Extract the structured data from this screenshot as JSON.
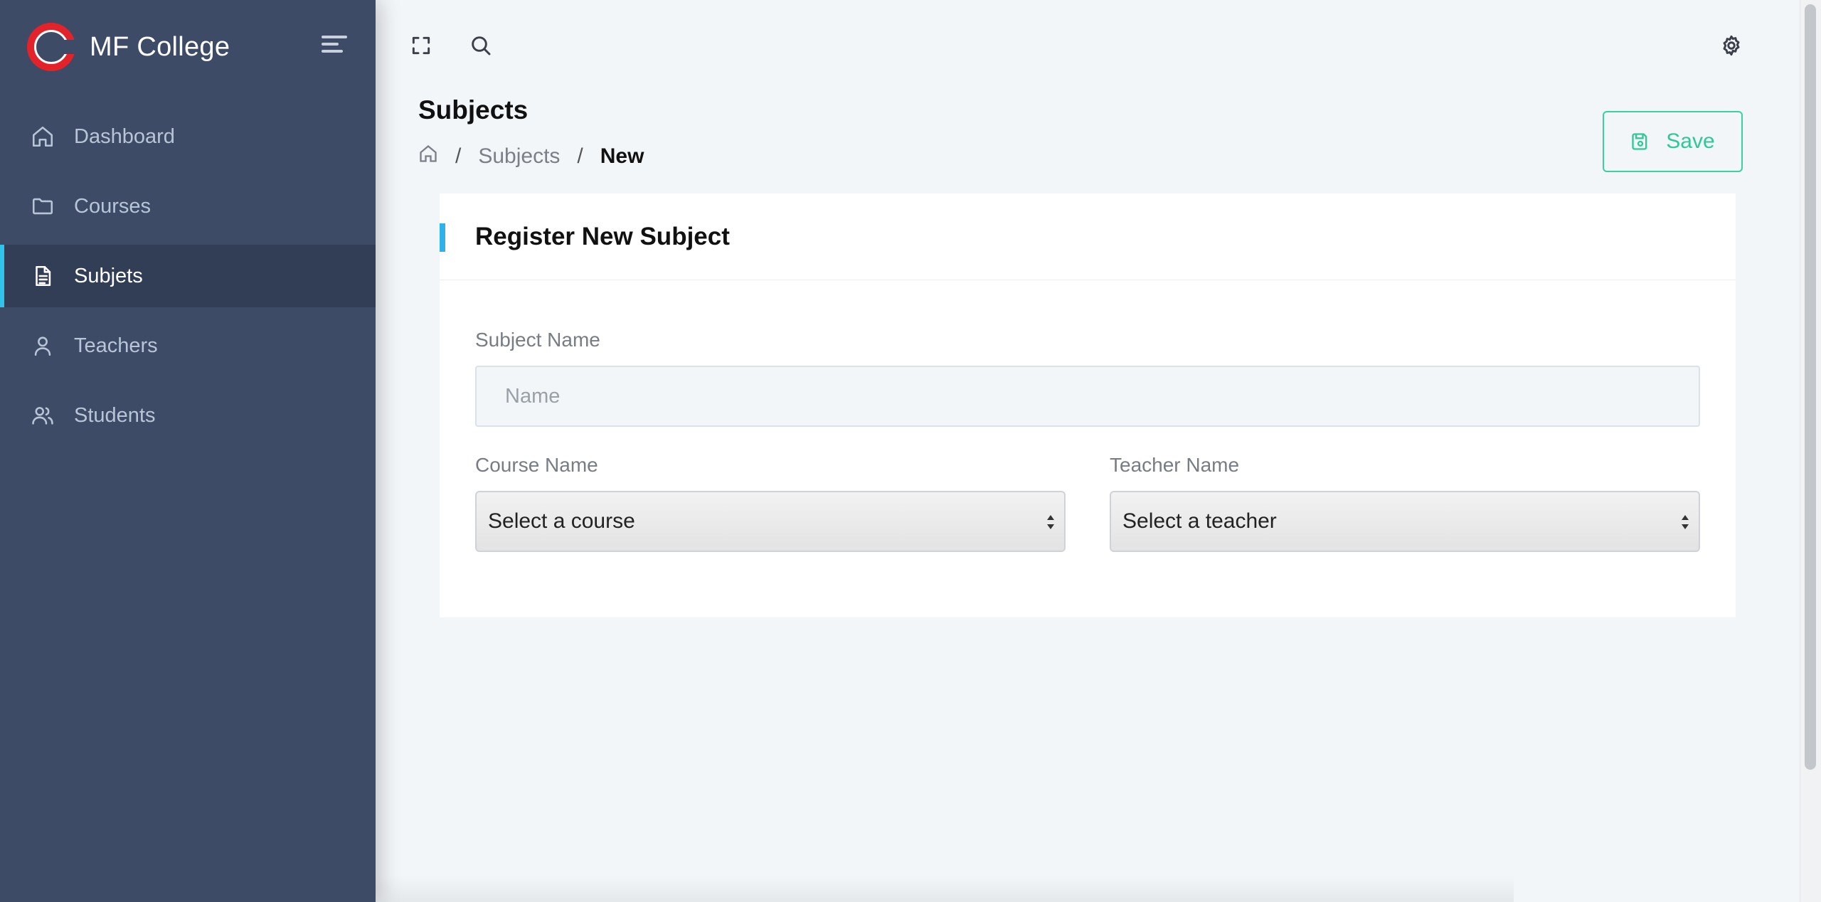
{
  "brand": {
    "name": "MF College",
    "logo_color": "#e32329"
  },
  "sidebar": {
    "background": "#3d4b66",
    "active_accent": "#2fc4ec",
    "items": [
      {
        "label": "Dashboard",
        "icon": "home-icon",
        "active": false
      },
      {
        "label": "Courses",
        "icon": "folder-icon",
        "active": false
      },
      {
        "label": "Subjets",
        "icon": "document-icon",
        "active": true
      },
      {
        "label": "Teachers",
        "icon": "user-icon",
        "active": false
      },
      {
        "label": "Students",
        "icon": "users-icon",
        "active": false
      }
    ]
  },
  "topbar": {
    "icons": [
      "fullscreen-icon",
      "search-icon",
      "settings-icon"
    ]
  },
  "header": {
    "title": "Subjects",
    "breadcrumb": {
      "home_icon": "home-icon",
      "section": "Subjects",
      "current": "New",
      "separator": "/"
    },
    "save_button": {
      "label": "Save",
      "icon": "save-icon",
      "color": "#2fc89a"
    }
  },
  "form": {
    "title": "Register New Subject",
    "accent": "#2fb2ec",
    "subject_name": {
      "label": "Subject Name",
      "placeholder": "Name",
      "value": ""
    },
    "course": {
      "label": "Course Name",
      "selected": "Select a course"
    },
    "teacher": {
      "label": "Teacher Name",
      "selected": "Select a teacher"
    }
  }
}
